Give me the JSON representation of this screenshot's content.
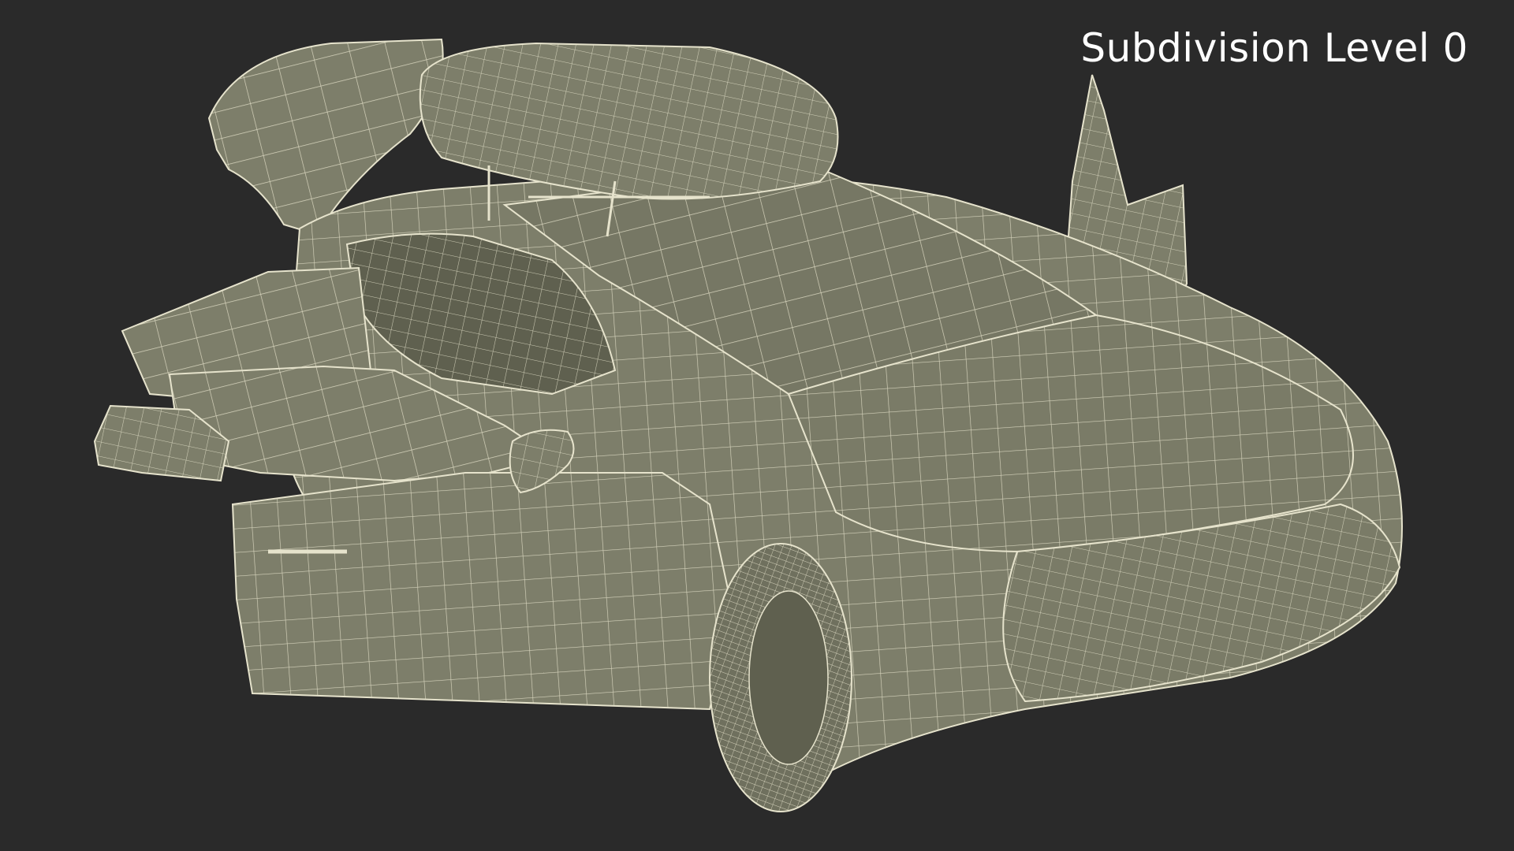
{
  "caption": "Subdivision Level 0",
  "colors": {
    "background": "#2a2a2a",
    "surface": "#7d7e6a",
    "surface_dark": "#5f604f",
    "wire": "#e6e3cc"
  }
}
